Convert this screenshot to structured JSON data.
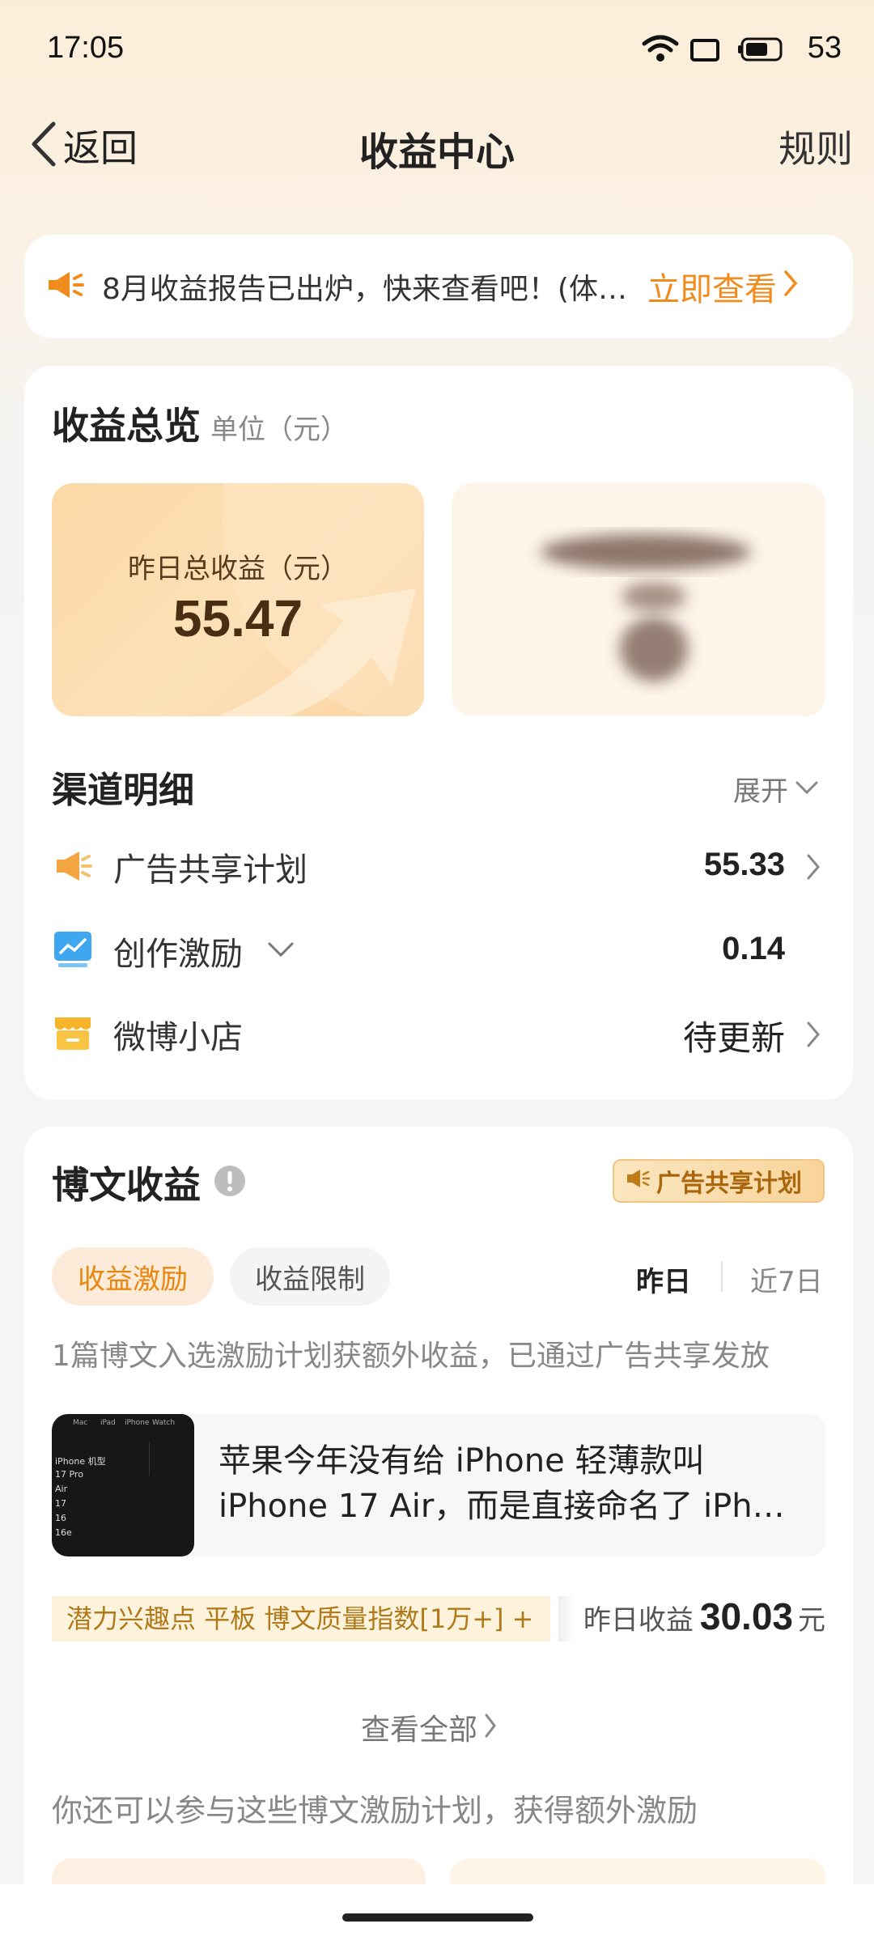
{
  "status_bar": {
    "time": "17:05",
    "battery": "53"
  },
  "nav": {
    "back_label": "返回",
    "title": "收益中心",
    "rules_label": "规则"
  },
  "notice": {
    "text": "8月收益报告已出炉，快来查看吧！(体…",
    "link": "立即查看"
  },
  "overview": {
    "title": "收益总览",
    "unit": "单位（元）",
    "yesterday_label": "昨日总收益（元）",
    "yesterday_value": "55.47"
  },
  "channels": {
    "title": "渠道明细",
    "expand_label": "展开",
    "items": [
      {
        "label": "广告共享计划",
        "value": "55.33"
      },
      {
        "label": "创作激励",
        "value": "0.14"
      },
      {
        "label": "微博小店",
        "value": "待更新"
      }
    ]
  },
  "posts": {
    "title": "博文收益",
    "ad_tag": "广告共享计划",
    "tabs": [
      "收益激励",
      "收益限制"
    ],
    "periods": [
      "昨日",
      "近7日"
    ],
    "summary": "1篇博文入选激励计划获额外收益，已通过广告共享发放",
    "article_title": "苹果今年没有给 iPhone 轻薄款叫 iPhone 17 Air，而是直接命名了 iPh…",
    "thumb_lines": [
      "Mac",
      "iPad",
      "iPhone",
      "Watch",
      "iPhone 机型",
      "17 Pro",
      "Air",
      "17",
      "16",
      "16e"
    ],
    "keywords": "潜力兴趣点 平板 博文质量指数[1万+] +",
    "earn_label": "昨日收益",
    "earn_value": "30.03",
    "earn_unit": "元",
    "view_all": "查看全部",
    "more_text": "你还可以参与这些博文激励计划，获得额外激励"
  }
}
